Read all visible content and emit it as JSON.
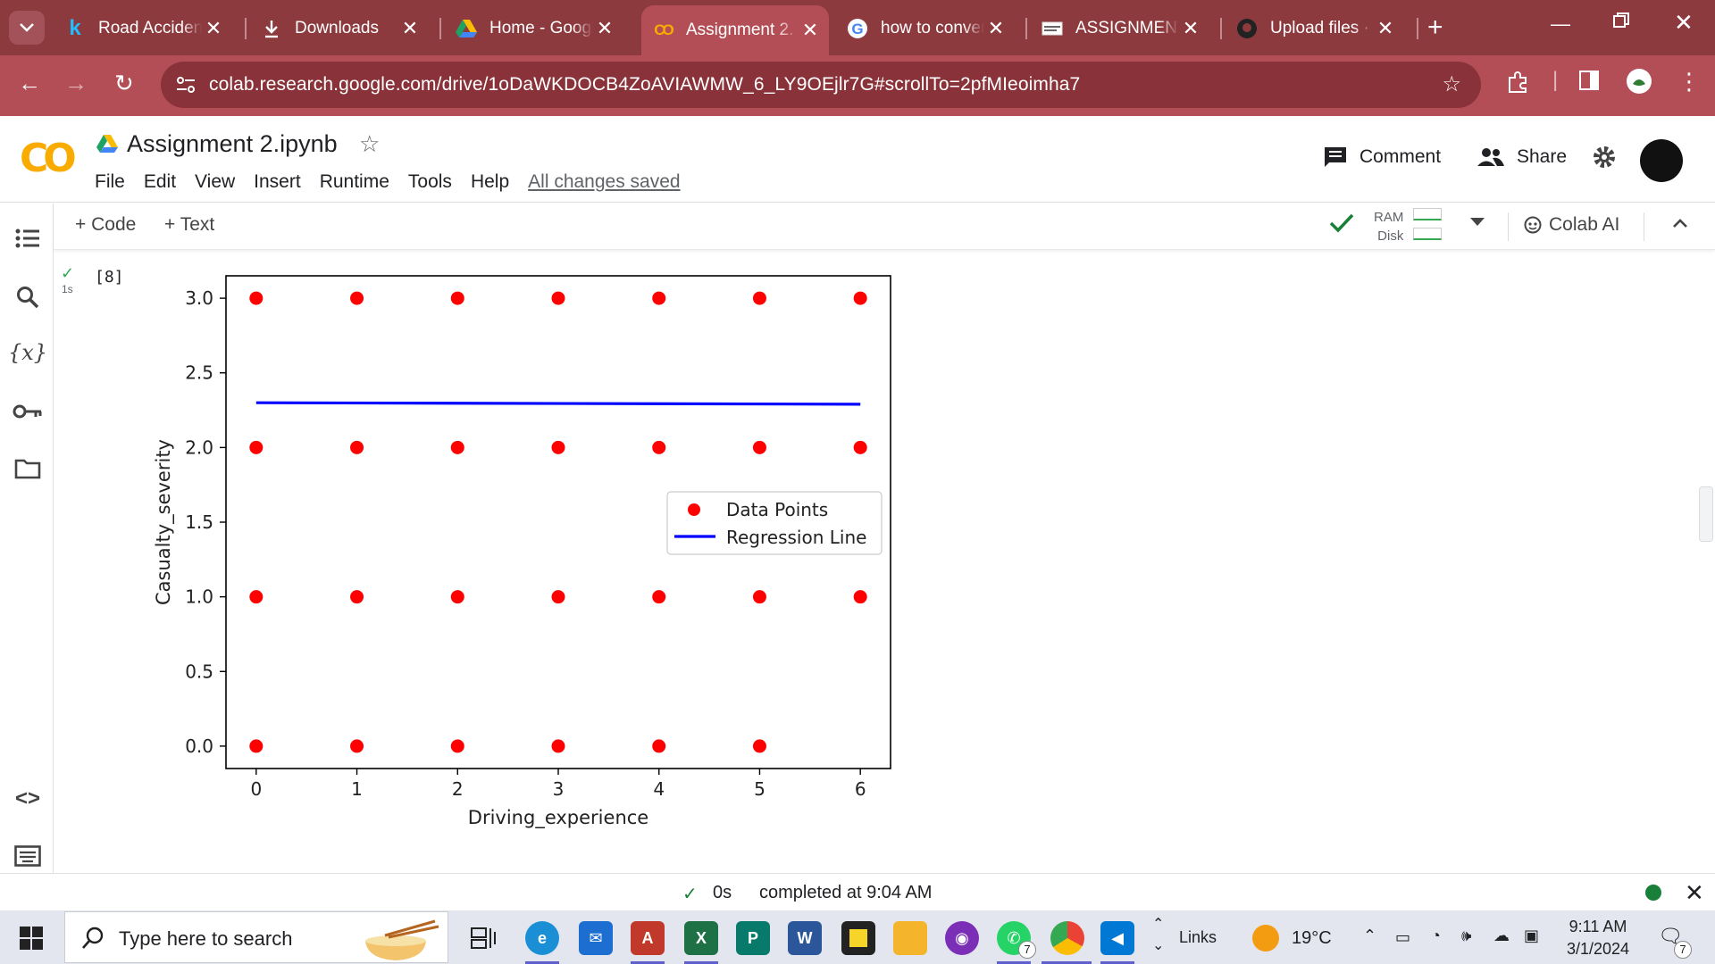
{
  "browser": {
    "tabs": [
      {
        "title": "Road Accident",
        "icon": "kaggle-icon",
        "active": false
      },
      {
        "title": "Downloads",
        "icon": "download-icon",
        "active": false
      },
      {
        "title": "Home - Googl",
        "icon": "google-drive-icon",
        "active": false
      },
      {
        "title": "Assignment 2.",
        "icon": "colab-icon",
        "active": true
      },
      {
        "title": "how to conver",
        "icon": "google-icon",
        "active": false
      },
      {
        "title": "ASSIGNMENT",
        "icon": "document-icon",
        "active": false
      },
      {
        "title": "Upload files ·",
        "icon": "github-icon",
        "active": false
      }
    ],
    "url": "colab.research.google.com/drive/1oDaWKDOCB4ZoAVIAWMW_6_LY9OEjlr7G#scrollTo=2pfMIeoimha7"
  },
  "colab": {
    "logo": "CO",
    "notebook_title": "Assignment 2.ipynb",
    "menu": [
      "File",
      "Edit",
      "View",
      "Insert",
      "Runtime",
      "Tools",
      "Help"
    ],
    "save_status": "All changes saved",
    "comment_label": "Comment",
    "share_label": "Share",
    "toolbar": {
      "code_label": "+ Code",
      "text_label": "+ Text",
      "ram_label": "RAM",
      "disk_label": "Disk",
      "ai_label": "Colab AI"
    },
    "cell": {
      "exec_count": "[8]",
      "exec_time": "1s"
    },
    "status": {
      "duration": "0s",
      "completed": "completed at 9:04 AM"
    }
  },
  "chart_data": {
    "type": "scatter",
    "xlabel": "Driving_experience",
    "ylabel": "Casualty_severity",
    "xlim": [
      -0.3,
      6.3
    ],
    "ylim": [
      -0.15,
      3.15
    ],
    "xticks": [
      "0",
      "1",
      "2",
      "3",
      "4",
      "5",
      "6"
    ],
    "yticks": [
      "0.0",
      "0.5",
      "1.0",
      "1.5",
      "2.0",
      "2.5",
      "3.0"
    ],
    "series": [
      {
        "name": "Data Points",
        "color": "#ff0000",
        "points": [
          [
            0,
            3
          ],
          [
            1,
            3
          ],
          [
            2,
            3
          ],
          [
            3,
            3
          ],
          [
            4,
            3
          ],
          [
            5,
            3
          ],
          [
            6,
            3
          ],
          [
            0,
            2
          ],
          [
            1,
            2
          ],
          [
            2,
            2
          ],
          [
            3,
            2
          ],
          [
            4,
            2
          ],
          [
            5,
            2
          ],
          [
            6,
            2
          ],
          [
            0,
            1
          ],
          [
            1,
            1
          ],
          [
            2,
            1
          ],
          [
            3,
            1
          ],
          [
            4,
            1
          ],
          [
            5,
            1
          ],
          [
            6,
            1
          ],
          [
            0,
            0
          ],
          [
            1,
            0
          ],
          [
            2,
            0
          ],
          [
            3,
            0
          ],
          [
            4,
            0
          ],
          [
            5,
            0
          ]
        ]
      },
      {
        "name": "Regression Line",
        "color": "#0000ff",
        "line": [
          [
            0,
            2.3
          ],
          [
            6,
            2.29
          ]
        ]
      }
    ],
    "legend": "center-right"
  },
  "taskbar": {
    "search_placeholder": "Type here to search",
    "links_label": "Links",
    "temperature": "19°C",
    "time": "9:11 AM",
    "date": "3/1/2024",
    "badges": {
      "whatsapp": "7",
      "notifications": "7"
    }
  }
}
